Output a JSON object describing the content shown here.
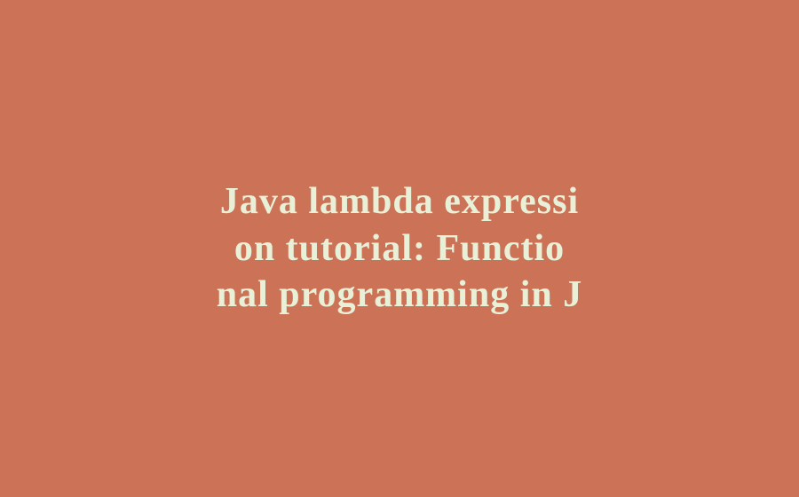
{
  "content": {
    "line1": "Java lambda expressi",
    "line2": "on tutorial: Functio",
    "line3": "nal programming in J"
  },
  "colors": {
    "background": "#cc7357",
    "text": "#e8f0d8"
  }
}
